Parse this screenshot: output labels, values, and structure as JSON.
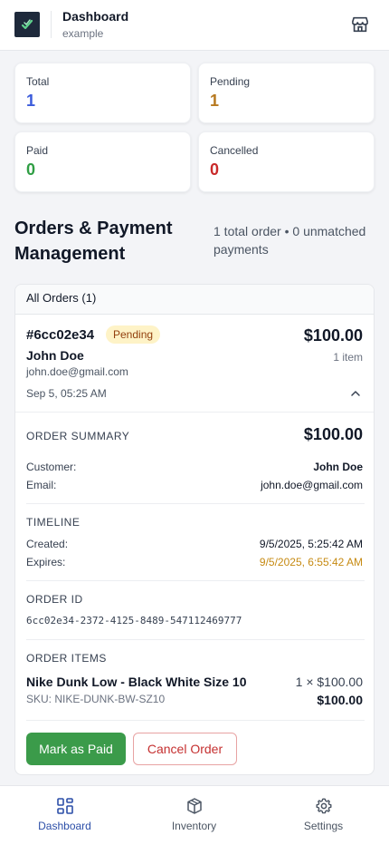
{
  "header": {
    "title": "Dashboard",
    "subtitle": "example",
    "store_icon": "store-icon"
  },
  "stats": [
    {
      "label": "Total",
      "value": "1",
      "color": "#3b5bdb"
    },
    {
      "label": "Pending",
      "value": "1",
      "color": "#b7791f"
    },
    {
      "label": "Paid",
      "value": "0",
      "color": "#2f9e44"
    },
    {
      "label": "Cancelled",
      "value": "0",
      "color": "#c92a2a"
    }
  ],
  "section": {
    "title": "Orders & Payment Management",
    "meta": "1 total order • 0 unmatched payments"
  },
  "orders_card": {
    "heading": "All Orders (1)",
    "order": {
      "id": "#6cc02e34",
      "status": "Pending",
      "amount": "$100.00",
      "item_count": "1 item",
      "customer_name": "John Doe",
      "customer_email": "john.doe@gmail.com",
      "date": "Sep 5, 05:25 AM"
    },
    "summary": {
      "label": "ORDER SUMMARY",
      "amount": "$100.00",
      "customer_label": "Customer:",
      "customer_value": "John Doe",
      "email_label": "Email:",
      "email_value": "john.doe@gmail.com"
    },
    "timeline": {
      "label": "TIMELINE",
      "created_label": "Created:",
      "created_value": "9/5/2025, 5:25:42 AM",
      "expires_label": "Expires:",
      "expires_value": "9/5/2025, 6:55:42 AM",
      "expires_color": "#c68a12"
    },
    "order_id": {
      "label": "ORDER ID",
      "value": "6cc02e34-2372-4125-8489-547112469777"
    },
    "items": {
      "label": "ORDER ITEMS",
      "list": [
        {
          "name": "Nike Dunk Low - Black White Size 10",
          "sku": "SKU: NIKE-DUNK-BW-SZ10",
          "qty_price": "1 × $100.00",
          "total": "$100.00"
        }
      ]
    },
    "actions": {
      "mark_paid": "Mark as Paid",
      "cancel": "Cancel Order"
    }
  },
  "tabbar": {
    "tabs": [
      {
        "label": "Dashboard",
        "icon": "grid-icon",
        "active": true
      },
      {
        "label": "Inventory",
        "icon": "box-icon",
        "active": false
      },
      {
        "label": "Settings",
        "icon": "gear-icon",
        "active": false
      }
    ],
    "active_color": "#2c4fa8"
  }
}
